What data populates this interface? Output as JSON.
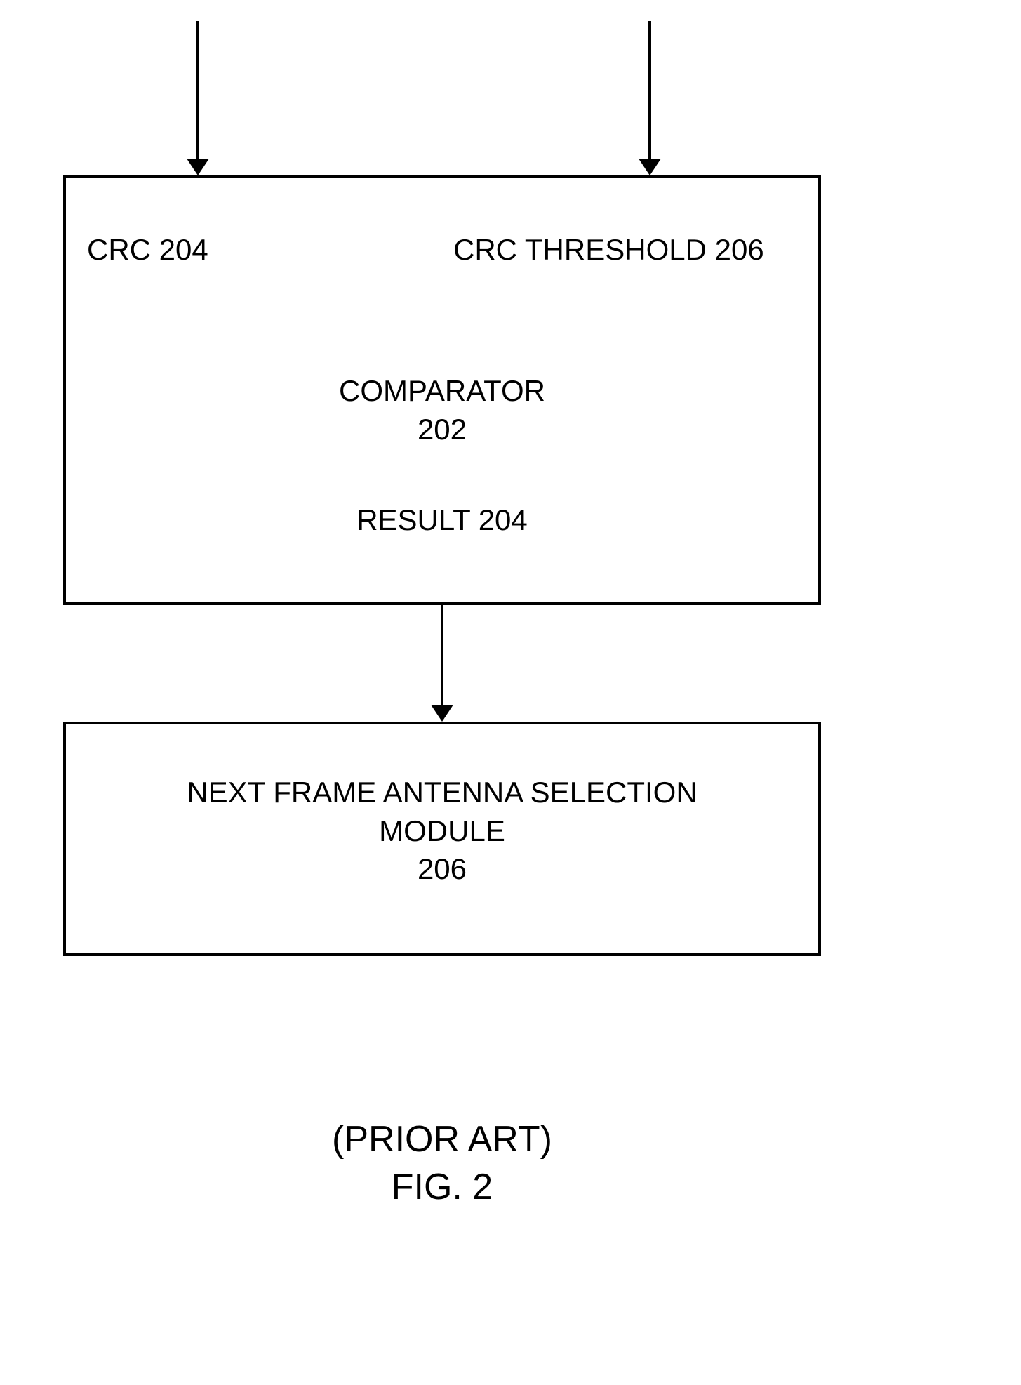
{
  "arrows": {
    "top_left": "",
    "top_right": "",
    "middle": ""
  },
  "comparator_box": {
    "input_left": "CRC 204",
    "input_right": "CRC  THRESHOLD 206",
    "title_line1": "COMPARATOR",
    "title_line2": "202",
    "result": "RESULT 204"
  },
  "selection_box": {
    "line1": "NEXT FRAME ANTENNA SELECTION",
    "line2": "MODULE",
    "line3": "206"
  },
  "caption": {
    "line1": "(PRIOR ART)",
    "line2": "FIG. 2"
  }
}
